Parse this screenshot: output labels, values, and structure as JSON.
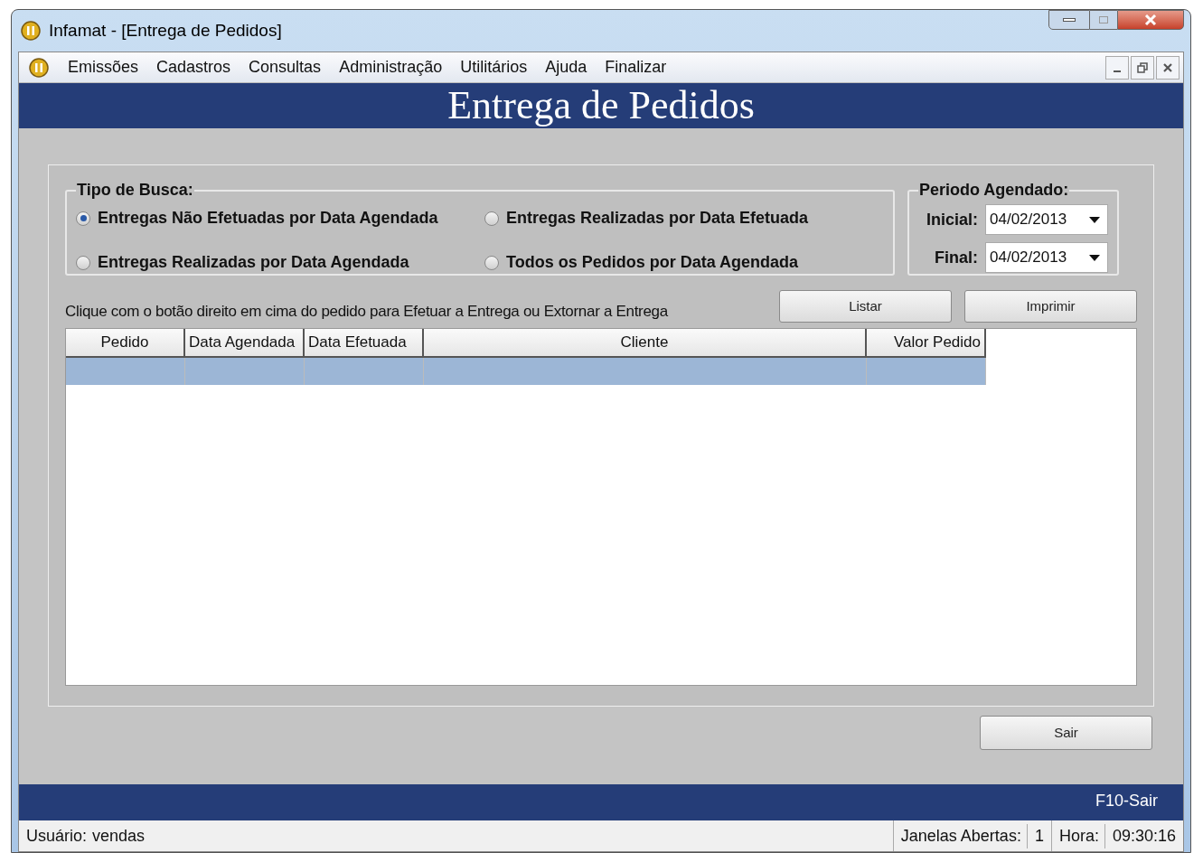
{
  "window": {
    "title": "Infamat - [Entrega de Pedidos]"
  },
  "menu": [
    "Emissões",
    "Cadastros",
    "Consultas",
    "Administração",
    "Utilitários",
    "Ajuda",
    "Finalizar"
  ],
  "header": {
    "title": "Entrega de Pedidos"
  },
  "search_type": {
    "legend": "Tipo de Busca:",
    "options": [
      {
        "label": "Entregas Não Efetuadas por Data Agendada",
        "selected": true
      },
      {
        "label": "Entregas Realizadas por Data Efetuada",
        "selected": false
      },
      {
        "label": "Entregas Realizadas por Data Agendada",
        "selected": false
      },
      {
        "label": "Todos os Pedidos por Data Agendada",
        "selected": false
      }
    ]
  },
  "period": {
    "legend": "Periodo Agendado:",
    "fields": [
      {
        "label": "Inicial:",
        "value": "04/02/2013"
      },
      {
        "label": "Final:",
        "value": "04/02/2013"
      }
    ]
  },
  "hint": "Clique com o botão direito em cima do pedido para Efetuar a Entrega ou Extornar a Entrega",
  "buttons": [
    "Listar",
    "Imprimir"
  ],
  "table": {
    "columns": [
      "Pedido",
      "Data Agendada",
      "Data Efetuada",
      "Cliente",
      "Valor Pedido"
    ],
    "rows": [
      {
        "selected": true
      }
    ]
  },
  "exit_button": "Sair",
  "footer": {
    "shortcut": "F10-Sair"
  },
  "status_bar": [
    {
      "label": "Usuário:",
      "value": "vendas"
    },
    {
      "label": "Janelas Abertas:",
      "value": "1"
    },
    {
      "label": "Hora:",
      "value": "09:30:16"
    }
  ]
}
